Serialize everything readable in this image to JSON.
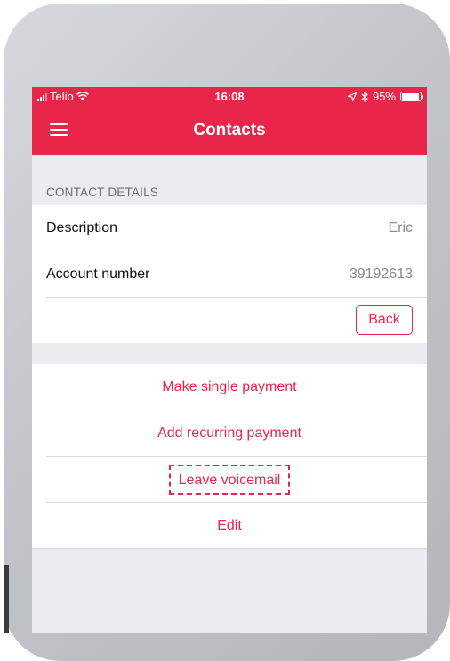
{
  "status_bar": {
    "carrier": "Telio",
    "time": "16:08",
    "battery_text": "95%",
    "battery_level": 0.95
  },
  "nav": {
    "title": "Contacts"
  },
  "contact_details": {
    "section_title": "CONTACT DETAILS",
    "rows": [
      {
        "label": "Description",
        "value": "Eric"
      },
      {
        "label": "Account number",
        "value": "39192613"
      }
    ],
    "back_label": "Back"
  },
  "actions": [
    {
      "label": "Make single payment"
    },
    {
      "label": "Add recurring payment"
    },
    {
      "label": "Leave voicemail"
    },
    {
      "label": "Edit"
    }
  ],
  "colors": {
    "accent": "#e8264a",
    "background": "#ececf0",
    "secondary_text": "#8a8a8f"
  }
}
